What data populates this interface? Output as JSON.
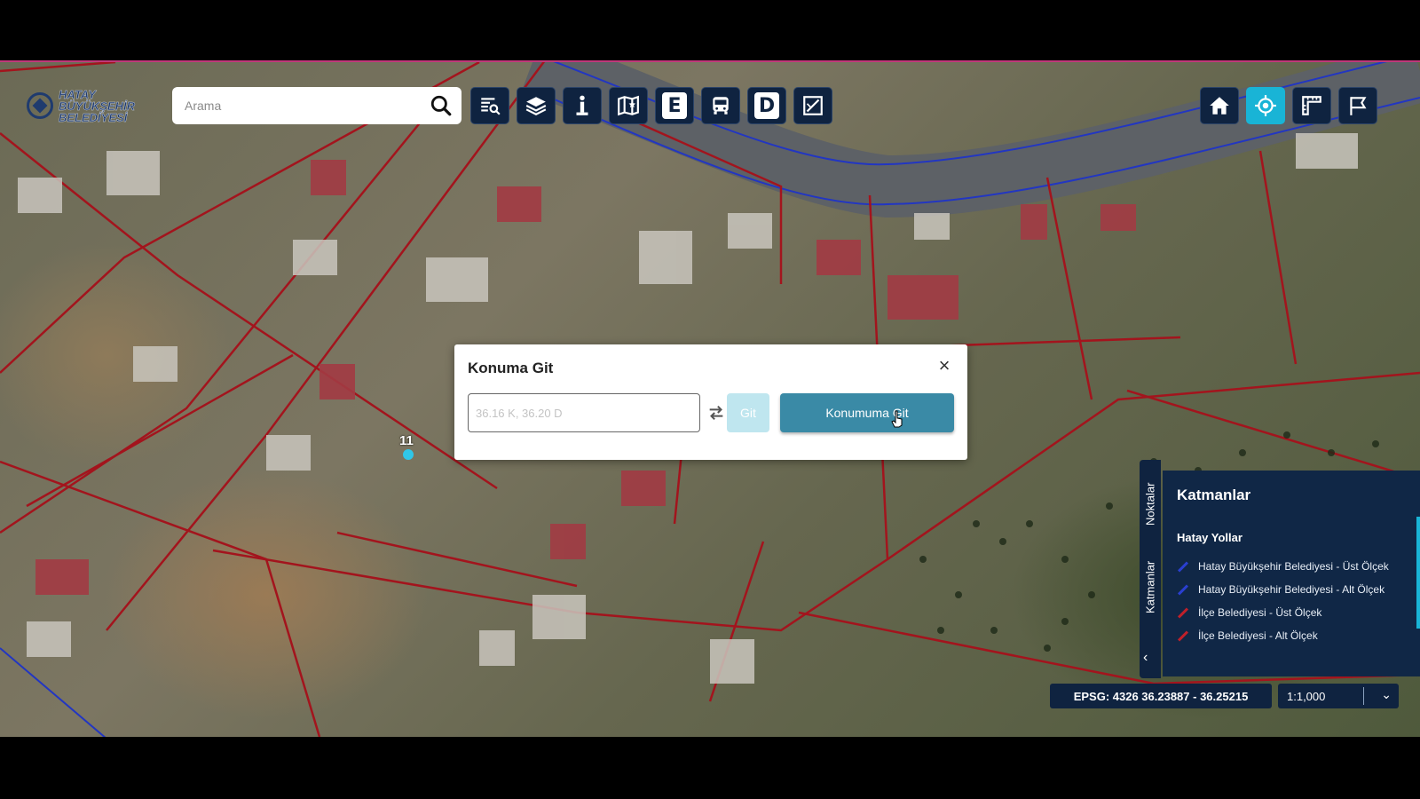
{
  "logo": {
    "line1": "HATAY",
    "line2": "BÜYÜKŞEHİR",
    "line3": "BELEDİYESİ"
  },
  "search": {
    "placeholder": "Arama",
    "value": ""
  },
  "toolbar": {
    "left_icons": [
      "list-search-icon",
      "layers-icon",
      "info-icon",
      "map-star-icon",
      "letter-e-icon",
      "bus-icon",
      "letter-d-icon",
      "draw-edit-icon"
    ],
    "letter_e": "E",
    "letter_d": "D",
    "right_icons": [
      "home-icon",
      "locate-icon",
      "ruler-icon",
      "flag-icon"
    ],
    "accent_color": "#19b4d6"
  },
  "dialog": {
    "title": "Konuma Git",
    "close_label": "×",
    "coord_placeholder": "36.16 K, 36.20 D",
    "coord_value": "",
    "git_label": "Git",
    "goto_label": "Konumuma Git"
  },
  "map": {
    "marker_label": "11"
  },
  "side_tabs": {
    "tab_points": "Noktalar",
    "tab_layers": "Katmanlar",
    "collapse": "‹"
  },
  "layers_panel": {
    "title": "Katmanlar",
    "group": "Hatay Yollar",
    "items": [
      {
        "label": "Hatay Büyükşehir Belediyesi - Üst Ölçek",
        "color": "#2a3fd0"
      },
      {
        "label": "Hatay Büyükşehir Belediyesi - Alt Ölçek",
        "color": "#2a3fd0"
      },
      {
        "label": "İlçe Belediyesi - Üst Ölçek",
        "color": "#c0202a"
      },
      {
        "label": "İlçe Belediyesi - Alt Ölçek",
        "color": "#c0202a"
      }
    ]
  },
  "status_bar": {
    "epsg": "EPSG: 4326 36.23887 - 36.25215",
    "scale": "1:1,000"
  }
}
